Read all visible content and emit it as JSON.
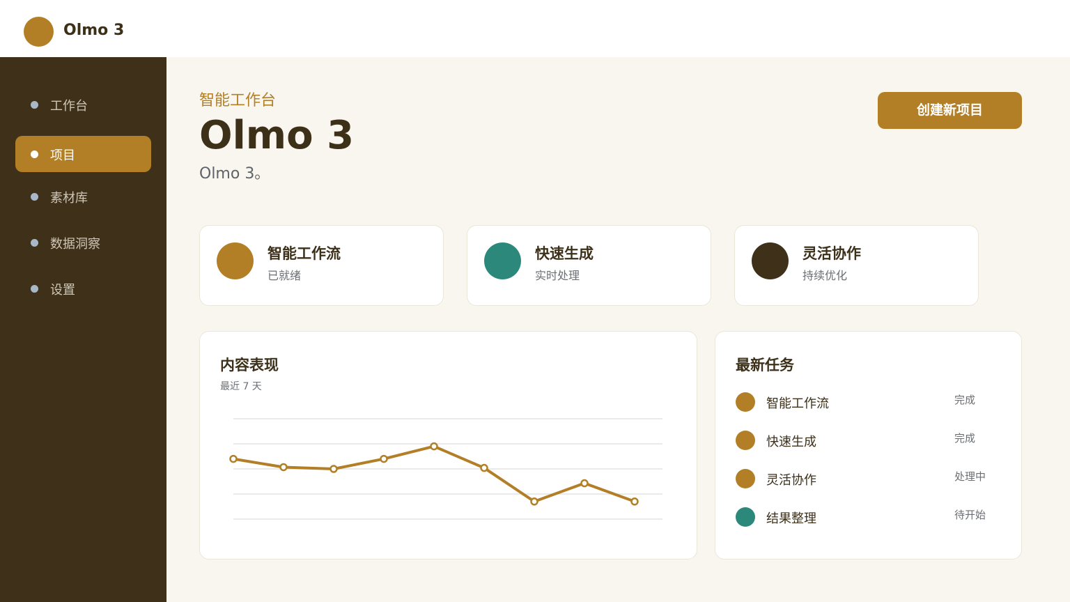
{
  "app": {
    "title": "Olmo 3",
    "brand_color": "#b27f27"
  },
  "sidebar": {
    "items": [
      {
        "label": "工作台",
        "icon": "dot-icon",
        "active": false
      },
      {
        "label": "项目",
        "icon": "dot-icon",
        "active": true
      },
      {
        "label": "素材库",
        "icon": "dot-icon",
        "active": false
      },
      {
        "label": "数据洞察",
        "icon": "dot-icon",
        "active": false
      },
      {
        "label": "设置",
        "icon": "dot-icon",
        "active": false
      }
    ]
  },
  "header": {
    "eyebrow": "智能工作台",
    "title": "Olmo 3",
    "subtitle": "Olmo 3。",
    "create_button": "创建新项目"
  },
  "stats": [
    {
      "title": "智能工作流",
      "subtitle": "已就绪",
      "color": "#b27f27"
    },
    {
      "title": "快速生成",
      "subtitle": "实时处理",
      "color": "#2c887b"
    },
    {
      "title": "灵活协作",
      "subtitle": "持续优化",
      "color": "#3e3019"
    }
  ],
  "chart_panel": {
    "title": "内容表现",
    "subtitle": "最近 7 天"
  },
  "chart_data": {
    "type": "line",
    "title": "内容表现",
    "subtitle": "最近 7 天",
    "xlabel": "",
    "ylabel": "",
    "x": [
      1,
      2,
      3,
      4,
      5,
      6,
      7,
      8,
      9
    ],
    "values": [
      2.4,
      2.07,
      2.0,
      2.4,
      2.9,
      2.04,
      0.7,
      1.43,
      0.7
    ],
    "ylim": [
      0,
      4
    ],
    "grid": true,
    "color": "#b27f27"
  },
  "tasks_panel": {
    "title": "最新任务",
    "items": [
      {
        "name": "智能工作流",
        "status": "完成",
        "color": "#b27f27"
      },
      {
        "name": "快速生成",
        "status": "完成",
        "color": "#b27f27"
      },
      {
        "name": "灵活协作",
        "status": "处理中",
        "color": "#b27f27"
      },
      {
        "name": "结果整理",
        "status": "待开始",
        "color": "#2c887b"
      }
    ]
  }
}
